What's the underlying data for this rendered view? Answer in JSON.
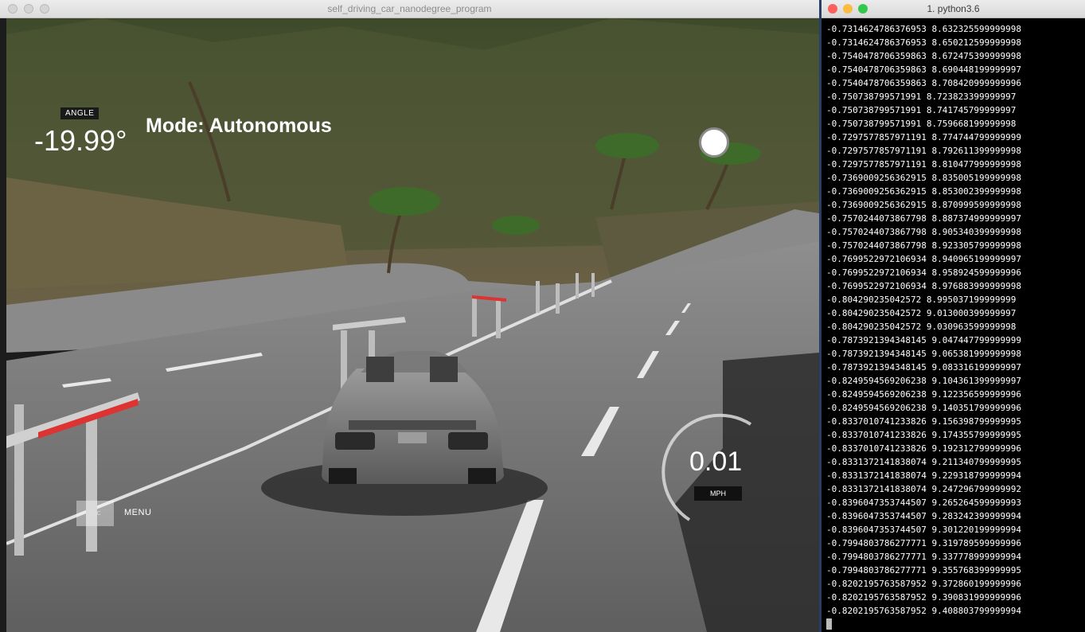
{
  "simulator": {
    "window_title": "self_driving_car_nanodegree_program",
    "angle_label": "ANGLE",
    "angle_value": "-19.99°",
    "mode_text": "Mode: Autonomous",
    "speed_value": "0.01",
    "speed_unit": "MPH",
    "esc_label": "ESC",
    "menu_label": "MENU"
  },
  "terminal": {
    "window_title": "1. python3.6",
    "lines": [
      "-0.7314624786376953 8.632325599999998",
      "-0.7314624786376953 8.650212599999998",
      "-0.7540478706359863 8.672475399999998",
      "-0.7540478706359863 8.690448199999997",
      "-0.7540478706359863 8.708420999999996",
      "-0.750738799571991 8.723823399999997",
      "-0.750738799571991 8.741745799999997",
      "-0.750738799571991 8.759668199999998",
      "-0.7297577857971191 8.774744799999999",
      "-0.7297577857971191 8.792611399999998",
      "-0.7297577857971191 8.810477999999998",
      "-0.7369009256362915 8.835005199999998",
      "-0.7369009256362915 8.853002399999998",
      "-0.7369009256362915 8.870999599999998",
      "-0.7570244073867798 8.887374999999997",
      "-0.7570244073867798 8.905340399999998",
      "-0.7570244073867798 8.923305799999998",
      "-0.7699522972106934 8.940965199999997",
      "-0.7699522972106934 8.958924599999996",
      "-0.7699522972106934 8.976883999999998",
      "-0.804290235042572 8.995037199999999",
      "-0.804290235042572 9.013000399999997",
      "-0.804290235042572 9.030963599999998",
      "-0.7873921394348145 9.047447799999999",
      "-0.7873921394348145 9.065381999999998",
      "-0.7873921394348145 9.083316199999997",
      "-0.8249594569206238 9.104361399999997",
      "-0.8249594569206238 9.122356599999996",
      "-0.8249594569206238 9.140351799999996",
      "-0.8337010741233826 9.156398799999995",
      "-0.8337010741233826 9.174355799999995",
      "-0.8337010741233826 9.192312799999996",
      "-0.8331372141838074 9.211340799999995",
      "-0.8331372141838074 9.229318799999994",
      "-0.8331372141838074 9.247296799999992",
      "-0.8396047353744507 9.265264599999993",
      "-0.8396047353744507 9.283242399999994",
      "-0.8396047353744507 9.301220199999994",
      "-0.7994803786277771 9.319789599999996",
      "-0.7994803786277771 9.337778999999994",
      "-0.7994803786277771 9.355768399999995",
      "-0.8202195763587952 9.372860199999996",
      "-0.8202195763587952 9.390831999999996",
      "-0.8202195763587952 9.408803799999994"
    ]
  }
}
